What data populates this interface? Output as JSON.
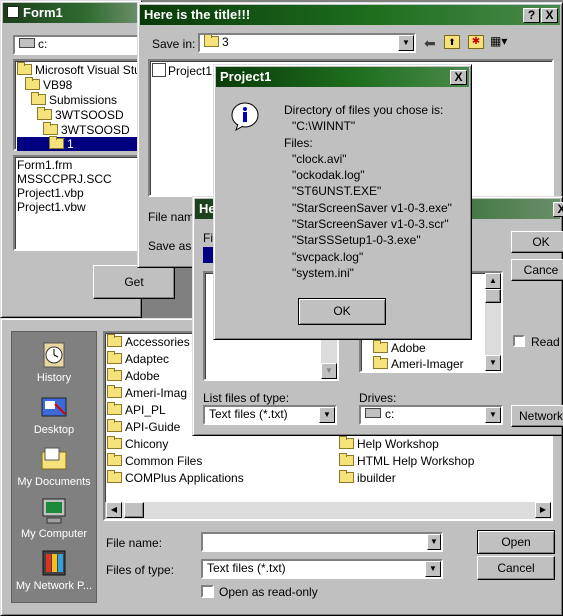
{
  "form1": {
    "title": "Form1",
    "drive_value": "c:",
    "dir_items": [
      "Microsoft Visual Stud",
      "VB98",
      "Submissions",
      "3WTSOOSD",
      "3WTSOOSD",
      "1"
    ],
    "file_items": [
      "Form1.frm",
      "MSSCCPRJ.SCC",
      "Project1.vbp",
      "Project1.vbw"
    ],
    "get_label": "Get"
  },
  "save_dialog": {
    "title": "Here is the title!!!",
    "help_label": "?",
    "close_label": "X",
    "save_in_label": "Save in:",
    "save_in_value": "3",
    "list_items": [
      "Project1"
    ],
    "file_name_label": "File name",
    "save_as_label": "Save as"
  },
  "vb_dialog": {
    "title": "He",
    "list_label": "Fil",
    "right_list_items": [
      "Adobe",
      "Ameri-Imager"
    ],
    "ok_label": "OK",
    "cancel_label": "Cance",
    "read_only_label": "Read o",
    "network_label": "Network",
    "list_type_label": "List files of type:",
    "list_type_value": "Text files (*.txt)",
    "drives_label": "Drives:",
    "drives_value": "c:"
  },
  "msgbox": {
    "title": "Project1",
    "close_label": "X",
    "lines": [
      "Directory of files you chose is:",
      "\"C:\\WINNT\"",
      "Files:",
      "\"clock.avi\"",
      "\"ockodak.log\"",
      "\"ST6UNST.EXE\"",
      "\"StarScreenSaver v1-0-3.exe\"",
      "\"StarScreenSaver v1-0-3.scr\"",
      "\"StarSSSetup1-0-3.exe\"",
      "\"svcpack.log\"",
      "\"system.ini\""
    ],
    "ok_label": "OK"
  },
  "open_dialog": {
    "places": [
      "History",
      "Desktop",
      "My Documents",
      "My Computer",
      "My Network P..."
    ],
    "col1": [
      "Accessories",
      "Adaptec",
      "Adobe",
      "Ameri-Imag",
      "API_PL",
      "API-Guide",
      "Chicony",
      "Common Files",
      "COMPlus Applications"
    ],
    "col2": [
      "Help Workshop",
      "HTML Help Workshop",
      "ibuilder"
    ],
    "file_name_label": "File name:",
    "file_name_value": "",
    "files_of_type_label": "Files of type:",
    "files_of_type_value": "Text files (*.txt)",
    "read_only_label": "Open as read-only",
    "open_label": "Open",
    "cancel_label": "Cancel"
  }
}
